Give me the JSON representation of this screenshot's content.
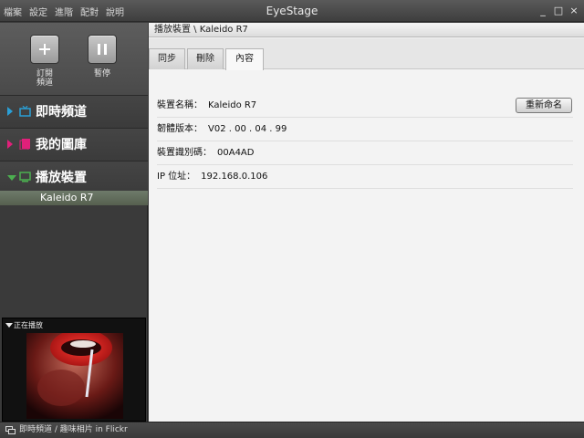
{
  "menu": [
    "檔案",
    "設定",
    "進階",
    "配對",
    "說明"
  ],
  "app_title": "EyeStage",
  "window_controls": {
    "minimize": "_",
    "maximize": "□",
    "close": "×"
  },
  "toolbar": {
    "subscribe_label_line1": "訂閱",
    "subscribe_label_line2": "頻道",
    "pause_label": "暫停"
  },
  "nav": {
    "live_channel": "即時頻道",
    "my_gallery": "我的圖庫",
    "playback_device": "播放裝置",
    "device_item": "Kaleido R7"
  },
  "now_playing": {
    "label": "正在播放"
  },
  "breadcrumb": "播放裝置 \\ Kaleido R7",
  "tabs": {
    "sync": "同步",
    "delete": "刪除",
    "content": "內容"
  },
  "properties": {
    "name_key": "裝置名稱：",
    "name_value": "Kaleido R7",
    "firmware_key": "韌體版本：",
    "firmware_value": "V02 . 00 . 04 . 99",
    "id_key": "裝置識別碼：",
    "id_value": "00A4AD",
    "ip_key": "IP 位址：",
    "ip_value": "192.168.0.106"
  },
  "rename_button": "重新命名",
  "status_bar": "即時頻道 / 趣味相片 in Flickr",
  "colors": {
    "accent": "#2a9fd6",
    "gallery_icon": "#e0207a",
    "device_icon": "#4caf50"
  }
}
